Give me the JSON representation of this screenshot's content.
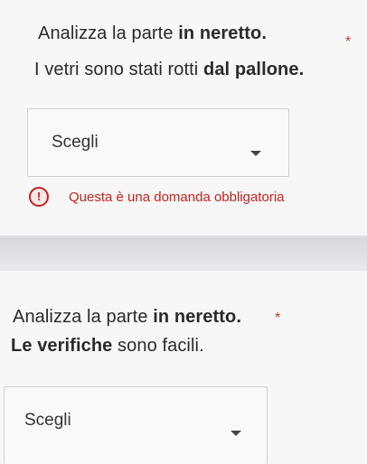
{
  "question1": {
    "prompt_plain": "Analizza la parte ",
    "prompt_bold": "in neretto.",
    "sentence_plain": "I vetri sono stati rotti ",
    "sentence_bold": "dal pallone.",
    "required_mark": "*",
    "select_value": "Scegli",
    "error_icon": "!",
    "error_text": "Questa è una domanda obbligatoria"
  },
  "question2": {
    "prompt_plain": "Analizza la parte ",
    "prompt_bold": "in neretto.",
    "required_mark": "*",
    "sentence_bold": "Le verifiche",
    "sentence_plain": " sono facili.",
    "select_value": "Scegli"
  },
  "icons": {
    "dropdown": "chevron-down-icon",
    "error": "exclamation-circle-icon"
  },
  "colors": {
    "required": "#c53929",
    "error": "#c5221f"
  }
}
